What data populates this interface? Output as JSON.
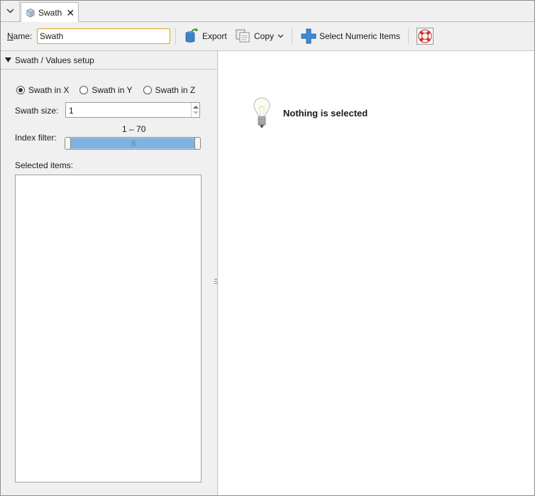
{
  "tab": {
    "menu_icon": "chevron-down-icon",
    "icon": "swath-cube-icon",
    "label": "Swath",
    "close": "✕"
  },
  "toolbar": {
    "name_label": "Name:",
    "name_value": "Swath",
    "export_label": "Export",
    "copy_label": "Copy",
    "select_label": "Select Numeric Items",
    "help_icon": "lifebuoy-icon"
  },
  "setup": {
    "section_title": "Swath / Values setup",
    "radios": [
      {
        "label": "Swath in X",
        "checked": true
      },
      {
        "label": "Swath in Y",
        "checked": false
      },
      {
        "label": "Swath in Z",
        "checked": false
      }
    ],
    "swath_size_label": "Swath size:",
    "swath_size_value": "1",
    "index_filter_label": "Index filter:",
    "index_filter_range": "1 – 70",
    "index_filter_min": 1,
    "index_filter_max": 70,
    "selected_items_label": "Selected items:",
    "selected_items": []
  },
  "main": {
    "empty_message": "Nothing is selected",
    "empty_icon": "lightbulb-icon"
  },
  "colors": {
    "accent": "#e3a21a",
    "range": "#7eb2e0",
    "add": "#2f7fd1"
  }
}
